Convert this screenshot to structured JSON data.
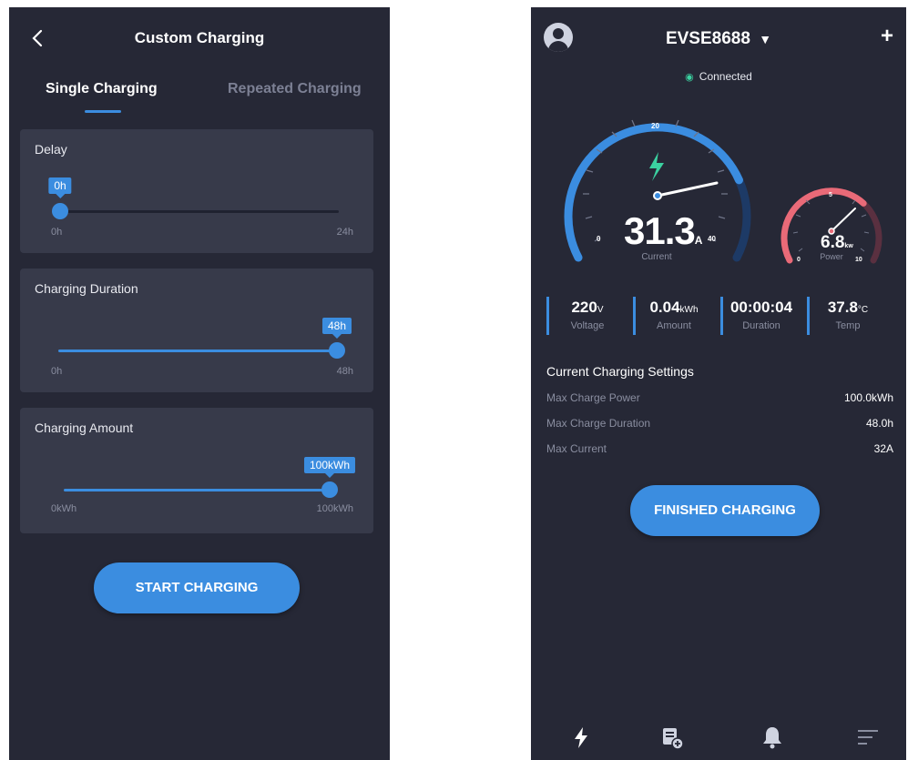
{
  "left": {
    "title": "Custom Charging",
    "tabs": [
      {
        "label": "Single Charging",
        "active": true
      },
      {
        "label": "Repeated Charging",
        "active": false
      }
    ],
    "sliders": [
      {
        "label": "Delay",
        "value_label": "0h",
        "min_label": "0h",
        "max_label": "24h",
        "fraction": 0.0
      },
      {
        "label": "Charging Duration",
        "value_label": "48h",
        "min_label": "0h",
        "max_label": "48h",
        "fraction": 1.0
      },
      {
        "label": "Charging Amount",
        "value_label": "100kWh",
        "min_label": "0kWh",
        "max_label": "100kWh",
        "fraction": 1.0
      }
    ],
    "start_button": "START CHARGING"
  },
  "right": {
    "device_name": "EVSE8688",
    "dropdown_icon": "caret-down-icon",
    "add_icon": "plus-icon",
    "status": "Connected",
    "current_gauge": {
      "value": "31.3",
      "unit": "A",
      "label": "Current",
      "ticks": [
        "0",
        "20",
        "40"
      ],
      "fraction": 0.78
    },
    "power_gauge": {
      "value": "6.8",
      "unit": "kw",
      "label": "Power",
      "ticks": [
        "0",
        "5",
        "10"
      ],
      "fraction": 0.68
    },
    "stats": [
      {
        "value": "220",
        "unit": "V",
        "label": "Voltage"
      },
      {
        "value": "0.04",
        "unit": "kWh",
        "label": "Amount"
      },
      {
        "value": "00:00:04",
        "unit": "",
        "label": "Duration"
      },
      {
        "value": "37.8",
        "unit": "°C",
        "label": "Temp"
      }
    ],
    "settings_title": "Current Charging Settings",
    "settings": [
      {
        "key": "Max Charge Power",
        "value": "100.0kWh"
      },
      {
        "key": "Max Charge Duration",
        "value": "48.0h"
      },
      {
        "key": "Max Current",
        "value": "32A"
      }
    ],
    "finish_button": "FINISHED CHARGING",
    "nav": [
      "lightning-icon",
      "document-add-icon",
      "bell-icon",
      "menu-icon"
    ]
  },
  "colors": {
    "background": "#262836",
    "card": "#373a4a",
    "accent": "#3b8de0",
    "power_gauge": "#e96a78",
    "status_green": "#3bd1a0"
  }
}
